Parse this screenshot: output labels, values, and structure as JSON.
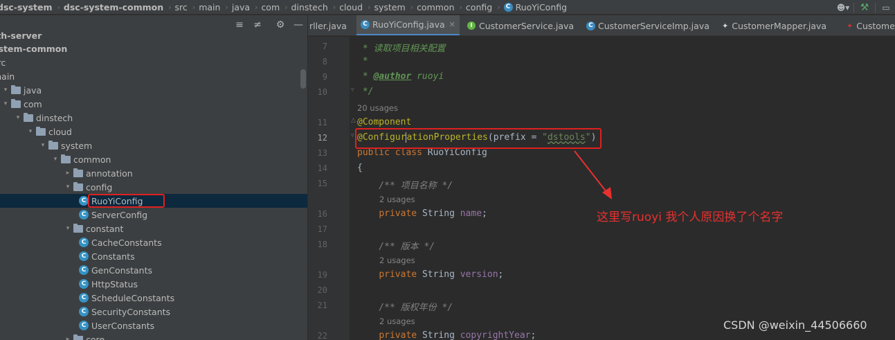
{
  "breadcrumbs": [
    {
      "label": "dsc-system",
      "bold": true
    },
    {
      "label": "dsc-system-common",
      "bold": true
    },
    {
      "label": "src"
    },
    {
      "label": "main"
    },
    {
      "label": "java"
    },
    {
      "label": "com"
    },
    {
      "label": "dinstech"
    },
    {
      "label": "cloud"
    },
    {
      "label": "system"
    },
    {
      "label": "common"
    },
    {
      "label": "config"
    },
    {
      "label": "RuoYiConfig",
      "icon": "C"
    }
  ],
  "project_tree": [
    {
      "label": "auth-server",
      "bold": true
    },
    {
      "label": "system-common",
      "bold": true
    },
    {
      "label": "src"
    },
    {
      "label": "main"
    },
    {
      "label": "java"
    },
    {
      "label": "com"
    },
    {
      "label": "dinstech"
    },
    {
      "label": "cloud"
    },
    {
      "label": "system"
    },
    {
      "label": "common"
    },
    {
      "label": "annotation"
    },
    {
      "label": "config"
    },
    {
      "label": "RuoYiConfig",
      "selected": true
    },
    {
      "label": "ServerConfig"
    },
    {
      "label": "constant"
    },
    {
      "label": "CacheConstants"
    },
    {
      "label": "Constants"
    },
    {
      "label": "GenConstants"
    },
    {
      "label": "HttpStatus"
    },
    {
      "label": "ScheduleConstants"
    },
    {
      "label": "SecurityConstants"
    },
    {
      "label": "UserConstants"
    },
    {
      "label": "core"
    }
  ],
  "tabs": [
    {
      "label": "rller.java"
    },
    {
      "label": "RuoYiConfig.java",
      "active": true
    },
    {
      "label": "CustomerService.java"
    },
    {
      "label": "CustomerServiceImp.java"
    },
    {
      "label": "CustomerMapper.java"
    },
    {
      "label": "Customer"
    }
  ],
  "editor": {
    "line_numbers": [
      "7",
      "8",
      "9",
      "10",
      "11",
      "12",
      "13",
      "14",
      "15",
      "16",
      "17",
      "18",
      "19",
      "20",
      "21",
      "22"
    ],
    "comment_read": "读取项目相关配置",
    "comment_star": "*",
    "author_tag": "@author",
    "author_name": "ruoyi",
    "comment_end": "*/",
    "usages_20": "20 usages",
    "annotation_component": "@Component",
    "annotation_config_a": "@Configur",
    "annotation_config_b": "ationProperties",
    "prefix_key": "prefix",
    "prefix_value": "dstools",
    "class_decl_kw": "public class",
    "class_name": "RuoYiConfig",
    "open_brace": "{",
    "comment_name": "项目名称",
    "usages_2": "2 usages",
    "field_kw": "private",
    "field_type": "String",
    "field_name": "name",
    "comment_version": "版本",
    "field_version": "version",
    "comment_copyright": "版权年份",
    "field_copyright": "copyrightYear"
  },
  "annotation_note": "这里写ruoyi 我个人原因换了个名字",
  "watermark": "CSDN @weixin_44506660",
  "colors": {
    "highlight_box": "#e02020",
    "note": "#e8312f"
  }
}
